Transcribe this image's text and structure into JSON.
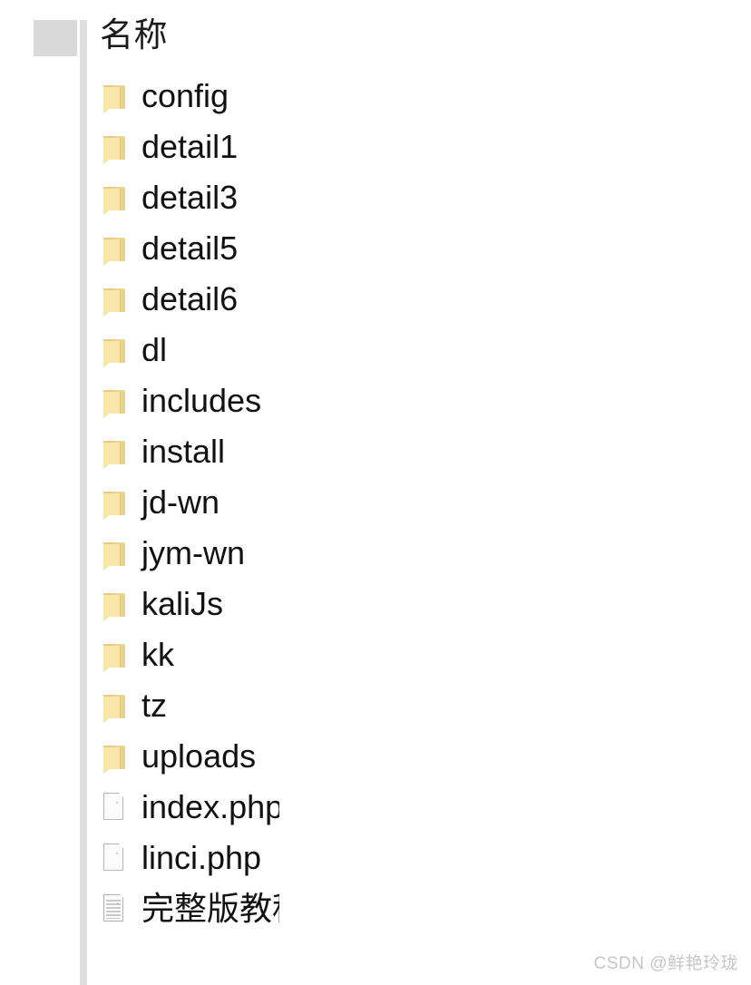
{
  "header": {
    "column_label": "名称"
  },
  "colors": {
    "folder_face": "#f7e6a8",
    "folder_back": "#e8d38a",
    "divider": "#dedede",
    "header_stub": "#d9d9d9",
    "scrollbar_thumb": "#7b7b7b",
    "text": "#111111",
    "watermark": "#c6c6c6"
  },
  "file_list": {
    "items": [
      {
        "name": "config",
        "icon": "folder-icon"
      },
      {
        "name": "detail1",
        "icon": "folder-icon"
      },
      {
        "name": "detail3",
        "icon": "folder-icon"
      },
      {
        "name": "detail5",
        "icon": "folder-icon"
      },
      {
        "name": "detail6",
        "icon": "folder-icon"
      },
      {
        "name": "dl",
        "icon": "folder-icon"
      },
      {
        "name": "includes",
        "icon": "folder-icon"
      },
      {
        "name": "install",
        "icon": "folder-icon"
      },
      {
        "name": "jd-wn",
        "icon": "folder-icon"
      },
      {
        "name": "jym-wn",
        "icon": "folder-icon"
      },
      {
        "name": "kaliJs",
        "icon": "folder-icon"
      },
      {
        "name": "kk",
        "icon": "folder-icon"
      },
      {
        "name": "tz",
        "icon": "folder-icon"
      },
      {
        "name": "uploads",
        "icon": "folder-icon"
      },
      {
        "name": "index.php",
        "icon": "file-icon"
      },
      {
        "name": "linci.php",
        "icon": "file-icon"
      },
      {
        "name": "完整版教程",
        "icon": "text-document-icon"
      }
    ]
  },
  "scrollbar": {
    "orientation": "vertical"
  },
  "watermark": {
    "text": "CSDN @鲜艳玲珑"
  }
}
